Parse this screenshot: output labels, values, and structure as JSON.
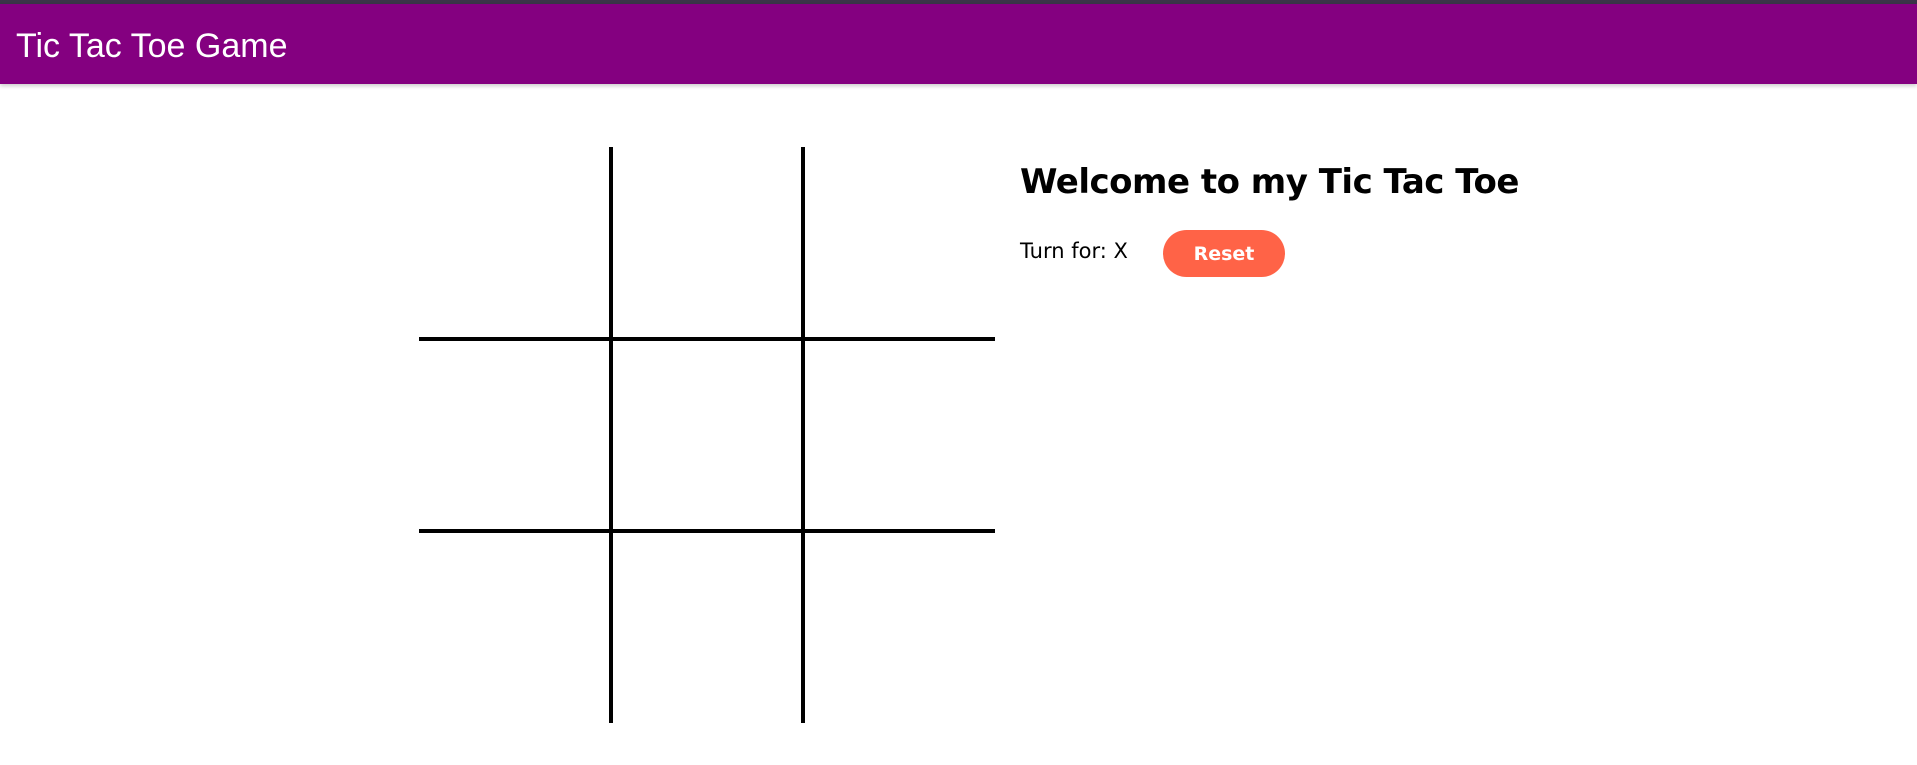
{
  "app_bar": {
    "title": "Tic Tac Toe Game",
    "color": "#840080"
  },
  "game": {
    "heading": "Welcome to my Tic Tac Toe",
    "turn_label": "Turn for:",
    "turn_player": "X",
    "reset_label": "Reset",
    "reset_color": "#ff6347",
    "board": [
      "",
      "",
      "",
      "",
      "",
      "",
      "",
      "",
      ""
    ]
  }
}
